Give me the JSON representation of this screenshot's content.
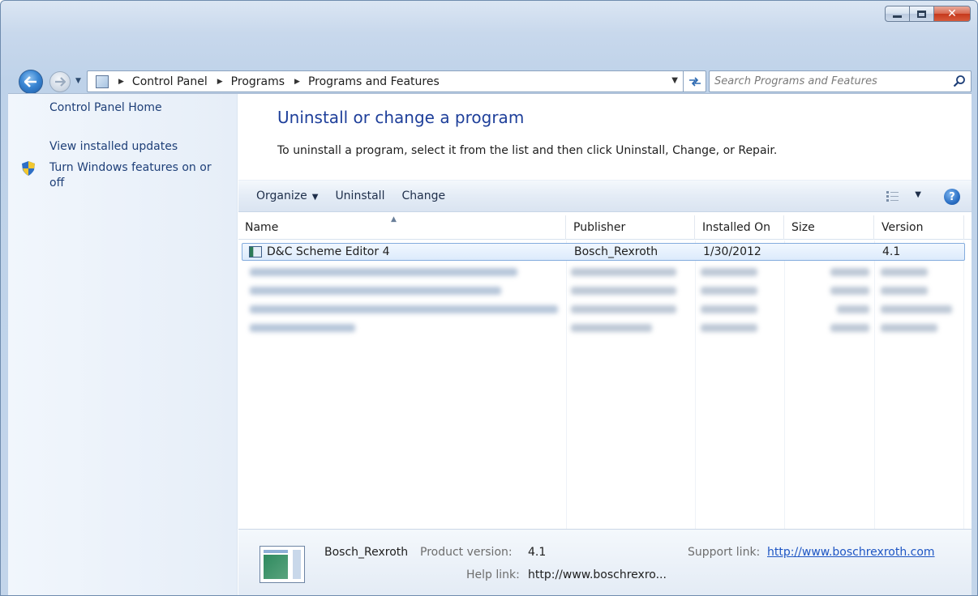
{
  "window": {
    "caption": {
      "minimize": "minimize",
      "maximize": "maximize",
      "close": "✕"
    }
  },
  "address": {
    "breadcrumbs": [
      "Control Panel",
      "Programs",
      "Programs and Features"
    ]
  },
  "search": {
    "placeholder": "Search Programs and Features"
  },
  "sidebar": {
    "links": [
      "Control Panel Home",
      "View installed updates",
      "Turn Windows features on or off"
    ]
  },
  "main": {
    "title": "Uninstall or change a program",
    "description": "To uninstall a program, select it from the list and then click Uninstall, Change, or Repair."
  },
  "toolbar": {
    "organize": "Organize",
    "uninstall": "Uninstall",
    "change": "Change",
    "help": "?"
  },
  "list": {
    "columns": [
      "Name",
      "Publisher",
      "Installed On",
      "Size",
      "Version"
    ],
    "rows": [
      {
        "name": "D&C Scheme Editor 4",
        "publisher": "Bosch_Rexroth",
        "installed_on": "1/30/2012",
        "size": "",
        "version": "4.1"
      }
    ]
  },
  "details": {
    "publisher": "Bosch_Rexroth",
    "product_version_label": "Product version:",
    "product_version": "4.1",
    "help_link_label": "Help link:",
    "help_link": "http://www.boschrexro...",
    "support_link_label": "Support link:",
    "support_link": "http://www.boschrexroth.com"
  },
  "colors": {
    "accent": "#1e3f9a",
    "link": "#1e56c4",
    "selection_border": "#84acdd"
  }
}
